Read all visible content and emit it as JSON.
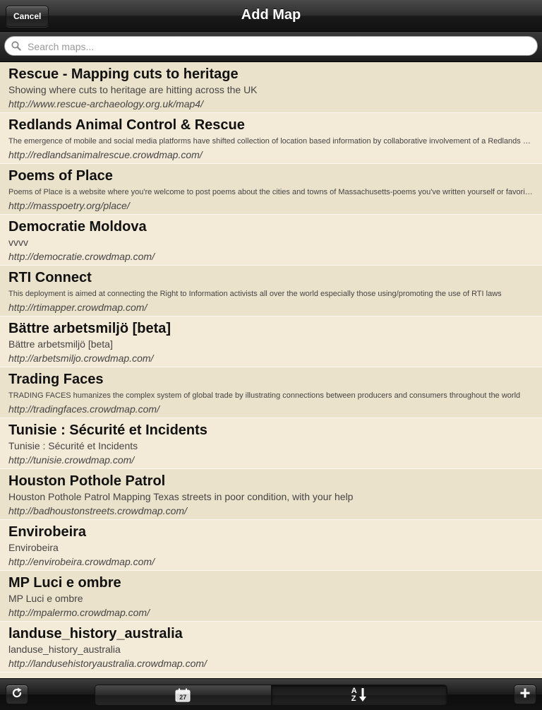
{
  "navbar": {
    "title": "Add Map",
    "cancel_label": "Cancel"
  },
  "search": {
    "placeholder": "Search maps...",
    "value": ""
  },
  "maps": [
    {
      "title": "Rescue - Mapping cuts to heritage",
      "description": "Showing where cuts to heritage are hitting across the UK",
      "url": "http://www.rescue-archaeology.org.uk/map4/",
      "small": false
    },
    {
      "title": "Redlands Animal Control & Rescue",
      "description": "The emergence of mobile and social media platforms have shifted collection of location based information by collaborative involvement of a Redlands community network and volunteers",
      "url": "http://redlandsanimalrescue.crowdmap.com/",
      "small": true
    },
    {
      "title": "Poems of Place",
      "description": "Poems of Place is a website where you're welcome to post poems about the cities and towns of Massachusetts-poems you've written yourself or favorites",
      "url": "http://masspoetry.org/place/",
      "small": true
    },
    {
      "title": "Democratie Moldova",
      "description": "vvvv",
      "url": "http://democratie.crowdmap.com/",
      "small": false
    },
    {
      "title": "RTI Connect",
      "description": "This deployment is aimed at connecting the Right to Information activists all over the world especially those using/promoting the use of RTI laws",
      "url": "http://rtimapper.crowdmap.com/",
      "small": true
    },
    {
      "title": "Bättre arbetsmiljö  [beta]",
      "description": "Bättre arbetsmiljö  [beta]",
      "url": "http://arbetsmiljo.crowdmap.com/",
      "small": false
    },
    {
      "title": "Trading Faces",
      "description": "TRADING FACES humanizes the complex system of global trade by illustrating connections between producers and consumers throughout the world",
      "url": "http://tradingfaces.crowdmap.com/",
      "small": true
    },
    {
      "title": "Tunisie : Sécurité et Incidents",
      "description": "Tunisie : Sécurité et Incidents",
      "url": "http://tunisie.crowdmap.com/",
      "small": false
    },
    {
      "title": "Houston Pothole Patrol",
      "description": "Houston Pothole Patrol  Mapping Texas streets in poor condition, with your help",
      "url": "http://badhoustonstreets.crowdmap.com/",
      "small": false
    },
    {
      "title": "Envirobeira",
      "description": "Envirobeira",
      "url": "http://envirobeira.crowdmap.com/",
      "small": false
    },
    {
      "title": "MP Luci e ombre",
      "description": "MP Luci e ombre",
      "url": "http://mpalermo.crowdmap.com/",
      "small": false
    },
    {
      "title": "landuse_history_australia",
      "description": "landuse_history_australia",
      "url": "http://landusehistoryaustralia.crowdmap.com/",
      "small": false
    }
  ],
  "toolbar": {
    "calendar_day": "27",
    "sort_top": "A",
    "sort_bottom": "Z",
    "selected_segment": "sort"
  },
  "colors": {
    "row_alt": "#ebe2cc",
    "row_plain": "#f3ead8"
  }
}
